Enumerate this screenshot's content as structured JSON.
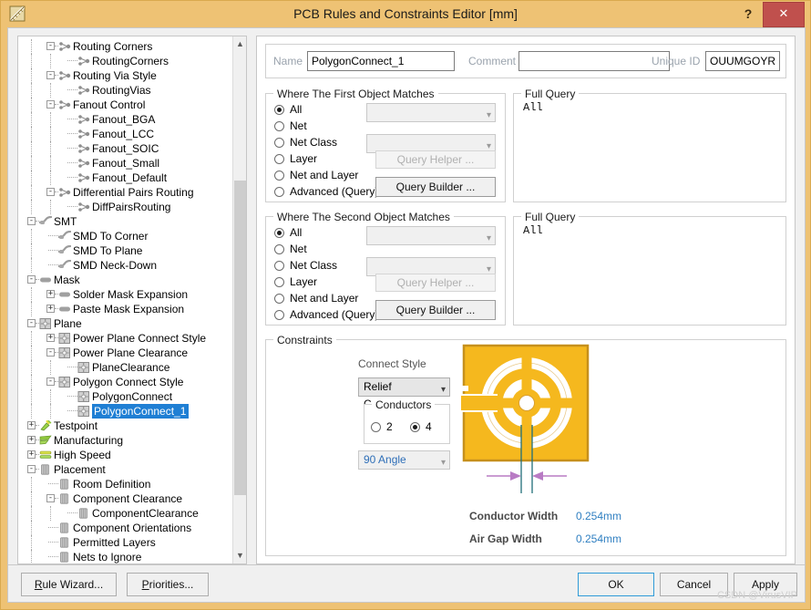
{
  "window": {
    "title": "PCB Rules and Constraints Editor [mm]",
    "app_icon": "ruler-icon",
    "help_label": "?",
    "close_label": "✕"
  },
  "tree": {
    "scroll_up_icon": "chevron-up-icon",
    "scroll_down_icon": "chevron-down-icon",
    "items": [
      {
        "label": "Routing Corners",
        "depth": 2,
        "expander": "-",
        "icon": "routing-icon",
        "selected": false
      },
      {
        "label": "RoutingCorners",
        "depth": 3,
        "expander": "",
        "icon": "routing-icon",
        "selected": false
      },
      {
        "label": "Routing Via Style",
        "depth": 2,
        "expander": "-",
        "icon": "routing-icon",
        "selected": false
      },
      {
        "label": "RoutingVias",
        "depth": 3,
        "expander": "",
        "icon": "routing-icon",
        "selected": false
      },
      {
        "label": "Fanout Control",
        "depth": 2,
        "expander": "-",
        "icon": "routing-icon",
        "selected": false
      },
      {
        "label": "Fanout_BGA",
        "depth": 3,
        "expander": "",
        "icon": "routing-icon",
        "selected": false
      },
      {
        "label": "Fanout_LCC",
        "depth": 3,
        "expander": "",
        "icon": "routing-icon",
        "selected": false
      },
      {
        "label": "Fanout_SOIC",
        "depth": 3,
        "expander": "",
        "icon": "routing-icon",
        "selected": false
      },
      {
        "label": "Fanout_Small",
        "depth": 3,
        "expander": "",
        "icon": "routing-icon",
        "selected": false
      },
      {
        "label": "Fanout_Default",
        "depth": 3,
        "expander": "",
        "icon": "routing-icon",
        "selected": false
      },
      {
        "label": "Differential Pairs Routing",
        "depth": 2,
        "expander": "-",
        "icon": "routing-icon",
        "selected": false
      },
      {
        "label": "DiffPairsRouting",
        "depth": 3,
        "expander": "",
        "icon": "routing-icon",
        "selected": false
      },
      {
        "label": "SMT",
        "depth": 1,
        "expander": "-",
        "icon": "smt-icon",
        "selected": false
      },
      {
        "label": "SMD To Corner",
        "depth": 2,
        "expander": "",
        "icon": "smt-icon",
        "selected": false
      },
      {
        "label": "SMD To Plane",
        "depth": 2,
        "expander": "",
        "icon": "smt-icon",
        "selected": false
      },
      {
        "label": "SMD Neck-Down",
        "depth": 2,
        "expander": "",
        "icon": "smt-icon",
        "selected": false
      },
      {
        "label": "Mask",
        "depth": 1,
        "expander": "-",
        "icon": "mask-icon",
        "selected": false
      },
      {
        "label": "Solder Mask Expansion",
        "depth": 2,
        "expander": "+",
        "icon": "mask-icon",
        "selected": false
      },
      {
        "label": "Paste Mask Expansion",
        "depth": 2,
        "expander": "+",
        "icon": "mask-icon",
        "selected": false
      },
      {
        "label": "Plane",
        "depth": 1,
        "expander": "-",
        "icon": "plane-icon",
        "selected": false
      },
      {
        "label": "Power Plane Connect Style",
        "depth": 2,
        "expander": "+",
        "icon": "plane-icon",
        "selected": false
      },
      {
        "label": "Power Plane Clearance",
        "depth": 2,
        "expander": "-",
        "icon": "plane-icon",
        "selected": false
      },
      {
        "label": "PlaneClearance",
        "depth": 3,
        "expander": "",
        "icon": "plane-icon",
        "selected": false
      },
      {
        "label": "Polygon Connect Style",
        "depth": 2,
        "expander": "-",
        "icon": "plane-icon",
        "selected": false
      },
      {
        "label": "PolygonConnect",
        "depth": 3,
        "expander": "",
        "icon": "plane-icon",
        "selected": false
      },
      {
        "label": "PolygonConnect_1",
        "depth": 3,
        "expander": "",
        "icon": "plane-icon",
        "selected": true
      },
      {
        "label": "Testpoint",
        "depth": 1,
        "expander": "+",
        "icon": "testpoint-icon",
        "selected": false
      },
      {
        "label": "Manufacturing",
        "depth": 1,
        "expander": "+",
        "icon": "manufacturing-icon",
        "selected": false
      },
      {
        "label": "High Speed",
        "depth": 1,
        "expander": "+",
        "icon": "highspeed-icon",
        "selected": false
      },
      {
        "label": "Placement",
        "depth": 1,
        "expander": "-",
        "icon": "placement-icon",
        "selected": false
      },
      {
        "label": "Room Definition",
        "depth": 2,
        "expander": "",
        "icon": "placement-icon",
        "selected": false
      },
      {
        "label": "Component Clearance",
        "depth": 2,
        "expander": "-",
        "icon": "placement-icon",
        "selected": false
      },
      {
        "label": "ComponentClearance",
        "depth": 3,
        "expander": "",
        "icon": "placement-icon",
        "selected": false
      },
      {
        "label": "Component Orientations",
        "depth": 2,
        "expander": "",
        "icon": "placement-icon",
        "selected": false
      },
      {
        "label": "Permitted Layers",
        "depth": 2,
        "expander": "",
        "icon": "placement-icon",
        "selected": false
      },
      {
        "label": "Nets to Ignore",
        "depth": 2,
        "expander": "",
        "icon": "placement-icon",
        "selected": false
      }
    ]
  },
  "header": {
    "name_label": "Name",
    "name_value": "PolygonConnect_1",
    "comment_label": "Comment",
    "comment_value": "",
    "unique_id_label": "Unique ID",
    "unique_id_value": "OUUMGOYR"
  },
  "first_object": {
    "title": "Where The First Object Matches",
    "options": [
      "All",
      "Net",
      "Net Class",
      "Layer",
      "Net and Layer",
      "Advanced (Query)"
    ],
    "selected": "All",
    "net_combo_value": "",
    "netclass_combo_value": "",
    "query_helper_label": "Query Helper ...",
    "query_builder_label": "Query Builder ...",
    "full_query_title": "Full Query",
    "full_query_text": "All"
  },
  "second_object": {
    "title": "Where The Second Object Matches",
    "options": [
      "All",
      "Net",
      "Net Class",
      "Layer",
      "Net and Layer",
      "Advanced (Query)"
    ],
    "selected": "All",
    "net_combo_value": "",
    "netclass_combo_value": "",
    "query_helper_label": "Query Helper ...",
    "query_builder_label": "Query Builder ...",
    "full_query_title": "Full Query",
    "full_query_text": "All"
  },
  "constraints": {
    "title": "Constraints",
    "connect_style_label": "Connect Style",
    "connect_style_value": "Relief Connect",
    "conductors_title": "Conductors",
    "conductors_options": [
      "2",
      "4"
    ],
    "conductors_selected": "4",
    "angle_value": "90 Angle",
    "conductor_width_label": "Conductor Width",
    "conductor_width_value": "0.254mm",
    "air_gap_width_label": "Air Gap Width",
    "air_gap_width_value": "0.254mm",
    "pad_color": "#f5b81e",
    "pad_border_color": "#c6901c",
    "dimension_arrow_color": "#b87bc4",
    "dimension_line_color": "#1f6e7a"
  },
  "footer": {
    "rule_wizard_label": "Rule Wizard...",
    "rule_wizard_mnemonic": "R",
    "priorities_label": "Priorities...",
    "priorities_mnemonic": "P",
    "ok_label": "OK",
    "cancel_label": "Cancel",
    "apply_label": "Apply"
  },
  "watermark": "CSDN @VirusVIP"
}
